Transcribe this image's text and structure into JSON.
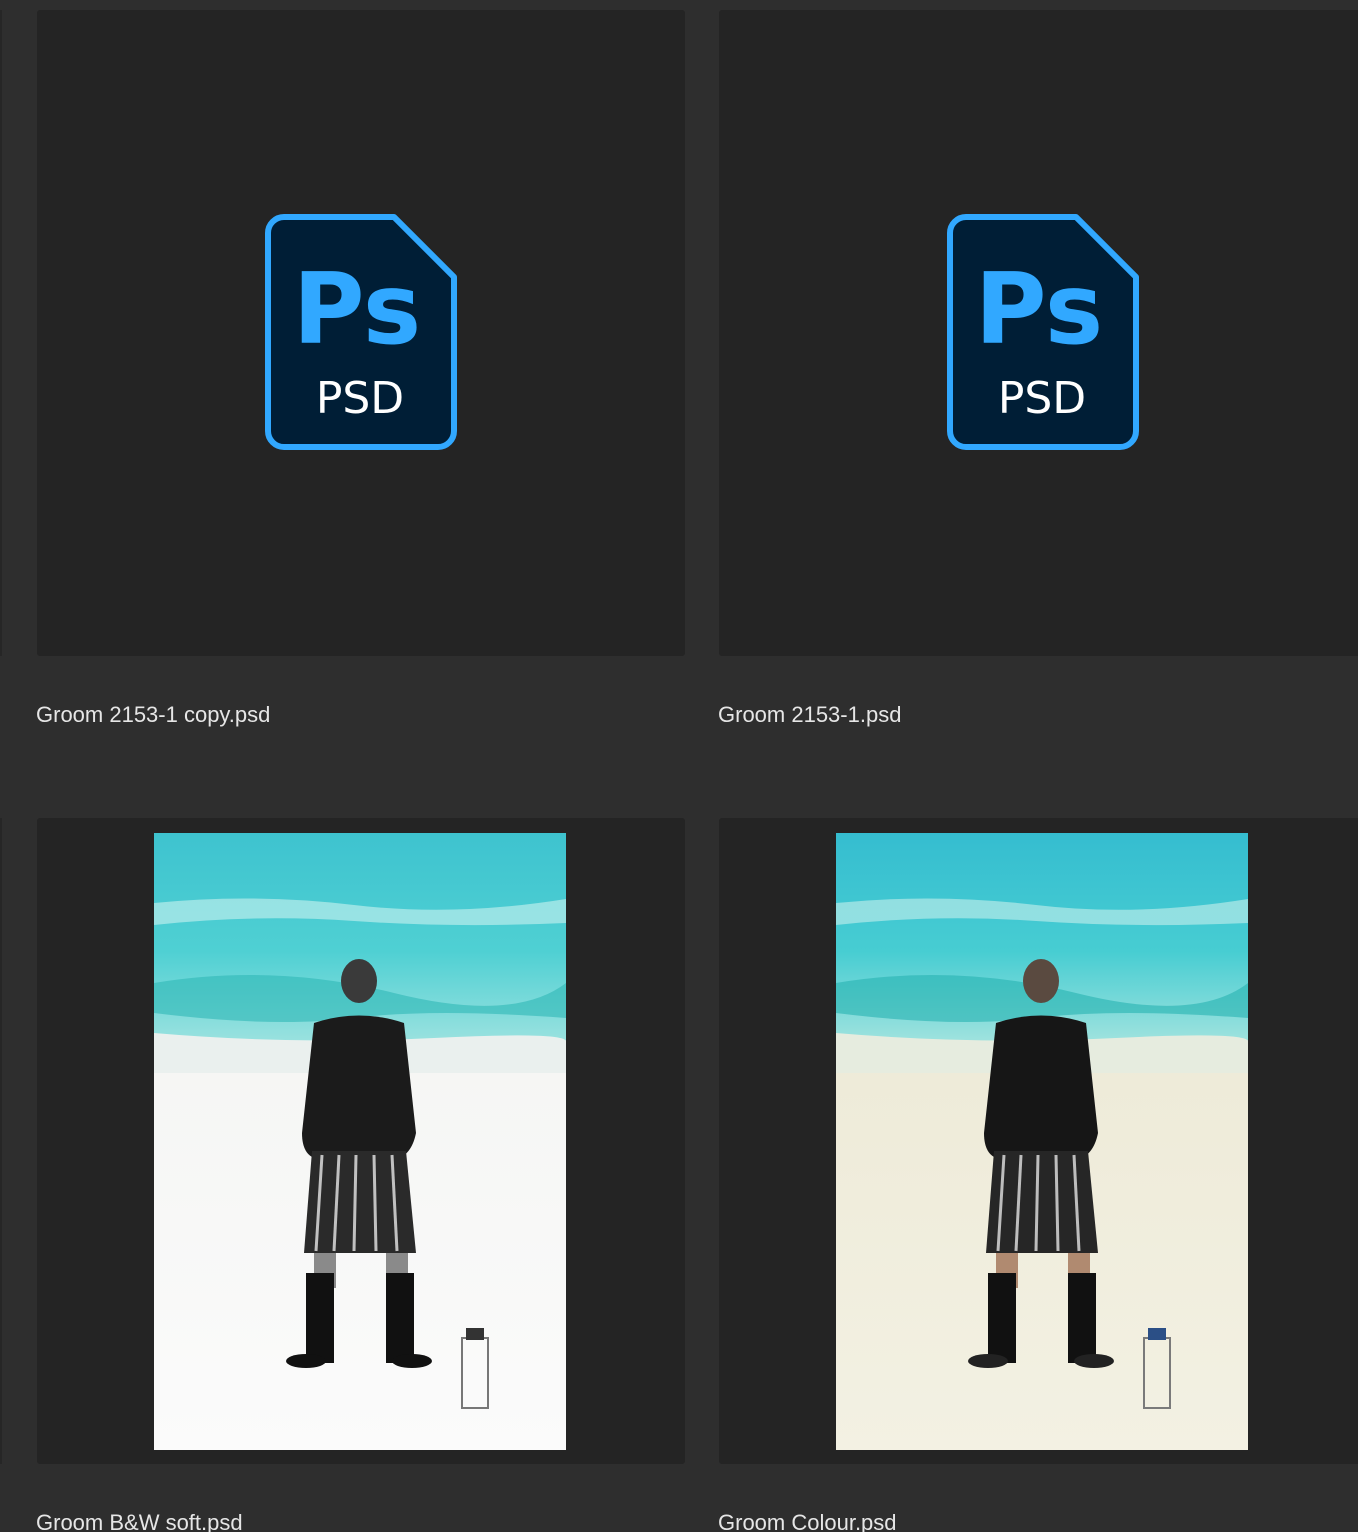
{
  "files": [
    {
      "name": "Groom 2153-1 copy.psd",
      "icon": {
        "type": "psd-icon",
        "mark": "Ps",
        "ext": "PSD"
      }
    },
    {
      "name": "Groom 2153-1.psd",
      "icon": {
        "type": "psd-icon",
        "mark": "Ps",
        "ext": "PSD"
      }
    },
    {
      "name": "Groom B&W soft.psd",
      "icon": {
        "type": "photo-thumbnail"
      }
    },
    {
      "name": "Groom Colour.psd",
      "icon": {
        "type": "photo-thumbnail"
      }
    }
  ],
  "colors": {
    "background": "#2e2e2e",
    "tile": "#242424",
    "ps_blue": "#31a8ff",
    "ps_dark": "#001e36",
    "filename_text": "#e6e6e6"
  }
}
